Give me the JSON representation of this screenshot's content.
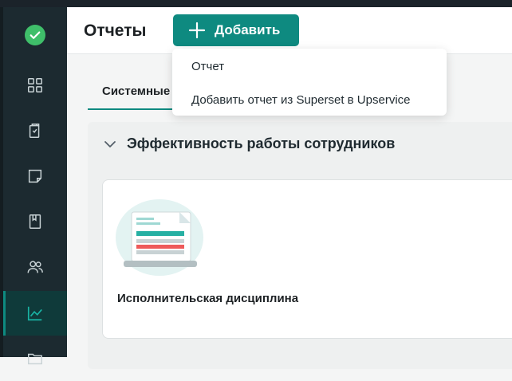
{
  "header": {
    "title": "Отчеты",
    "add_button_label": "Добавить"
  },
  "dropdown": {
    "items": [
      "Отчет",
      "Добавить отчет из Superset в Upservice"
    ]
  },
  "tabs": [
    {
      "label": "Системные"
    }
  ],
  "section": {
    "title": "Эффективность работы сотрудников"
  },
  "cards": [
    {
      "title": "Исполнительская дисциплина"
    }
  ],
  "sidebar": {
    "icons": [
      "logo-check-icon",
      "dashboard-grid-icon",
      "clipboard-icon",
      "note-icon",
      "book-icon",
      "users-icon",
      "chart-icon",
      "folder-icon"
    ],
    "active": "chart-icon"
  },
  "colors": {
    "accent": "#0e8a80",
    "sidebar_bg": "#1c2a30",
    "logo_green": "#3fbf6a"
  }
}
